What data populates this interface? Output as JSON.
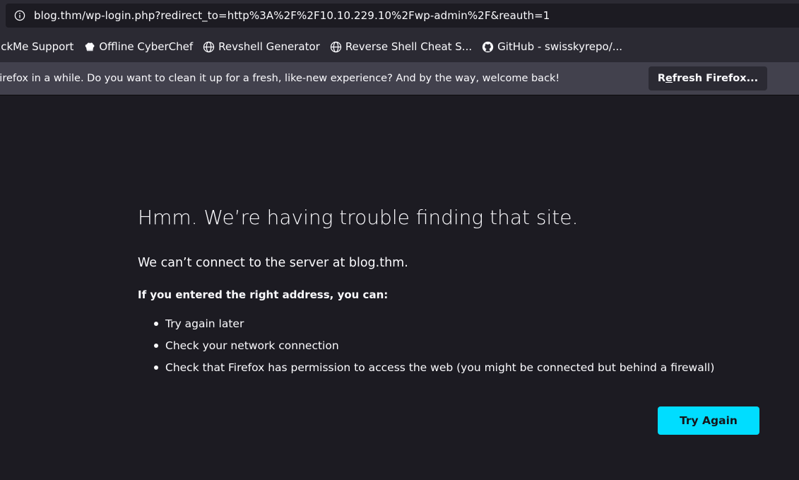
{
  "urlbar": {
    "url": "blog.thm/wp-login.php?redirect_to=http%3A%2F%2F10.10.229.10%2Fwp-admin%2F&reauth=1",
    "icon": "info-icon"
  },
  "bookmarks": [
    {
      "label": "ackMe Support",
      "icon": ""
    },
    {
      "label": "Offline CyberChef",
      "icon": "chef-hat-icon"
    },
    {
      "label": "Revshell Generator",
      "icon": "globe-icon"
    },
    {
      "label": "Reverse Shell Cheat S...",
      "icon": "globe-icon"
    },
    {
      "label": "GitHub - swisskyrepo/...",
      "icon": "github-icon"
    }
  ],
  "notification": {
    "message": "Firefox in a while. Do you want to clean it up for a fresh, like-new experience? And by the way, welcome back!",
    "button_prefix": "R",
    "button_underline": "e",
    "button_rest": "fresh Firefox..."
  },
  "error_page": {
    "title": "Hmm. We’re having trouble finding that site.",
    "description": "We can’t connect to the server at blog.thm.",
    "hint": "If you entered the right address, you can:",
    "suggestions": [
      "Try again later",
      "Check your network connection",
      "Check that Firefox has permission to access the web (you might be connected but behind a firewall)"
    ],
    "try_again_label": "Try Again"
  },
  "colors": {
    "background": "#1c1b22",
    "toolbar": "#2b2a33",
    "notification_bar": "#42414d",
    "accent_button": "#00ddff"
  }
}
